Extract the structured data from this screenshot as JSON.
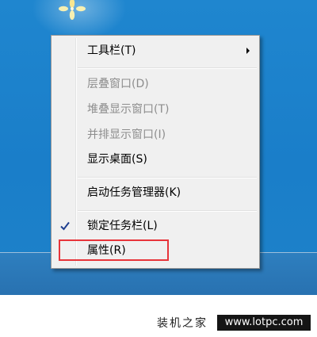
{
  "context_menu": {
    "items": [
      {
        "label": "工具栏(T)",
        "has_submenu": true,
        "disabled": false
      },
      {
        "label": "层叠窗口(D)",
        "disabled": true
      },
      {
        "label": "堆叠显示窗口(T)",
        "disabled": true
      },
      {
        "label": "并排显示窗口(I)",
        "disabled": true
      },
      {
        "label": "显示桌面(S)",
        "disabled": false
      },
      {
        "label": "启动任务管理器(K)",
        "disabled": false
      },
      {
        "label": "锁定任务栏(L)",
        "checked": true,
        "disabled": false
      },
      {
        "label": "属性(R)",
        "highlighted": true,
        "disabled": false
      }
    ],
    "highlight_color": "#e7343a"
  },
  "watermark": {
    "text": "装机之家",
    "url": "www.lotpc.com"
  },
  "icons": {
    "desktop_decoration": "windows-flower-icon",
    "submenu": "submenu-arrow-icon",
    "checked": "checkmark-icon"
  },
  "colors": {
    "desktop": "#1f86cf",
    "menu_bg": "#f0f0f0",
    "disabled_text": "#8d8d8d"
  }
}
